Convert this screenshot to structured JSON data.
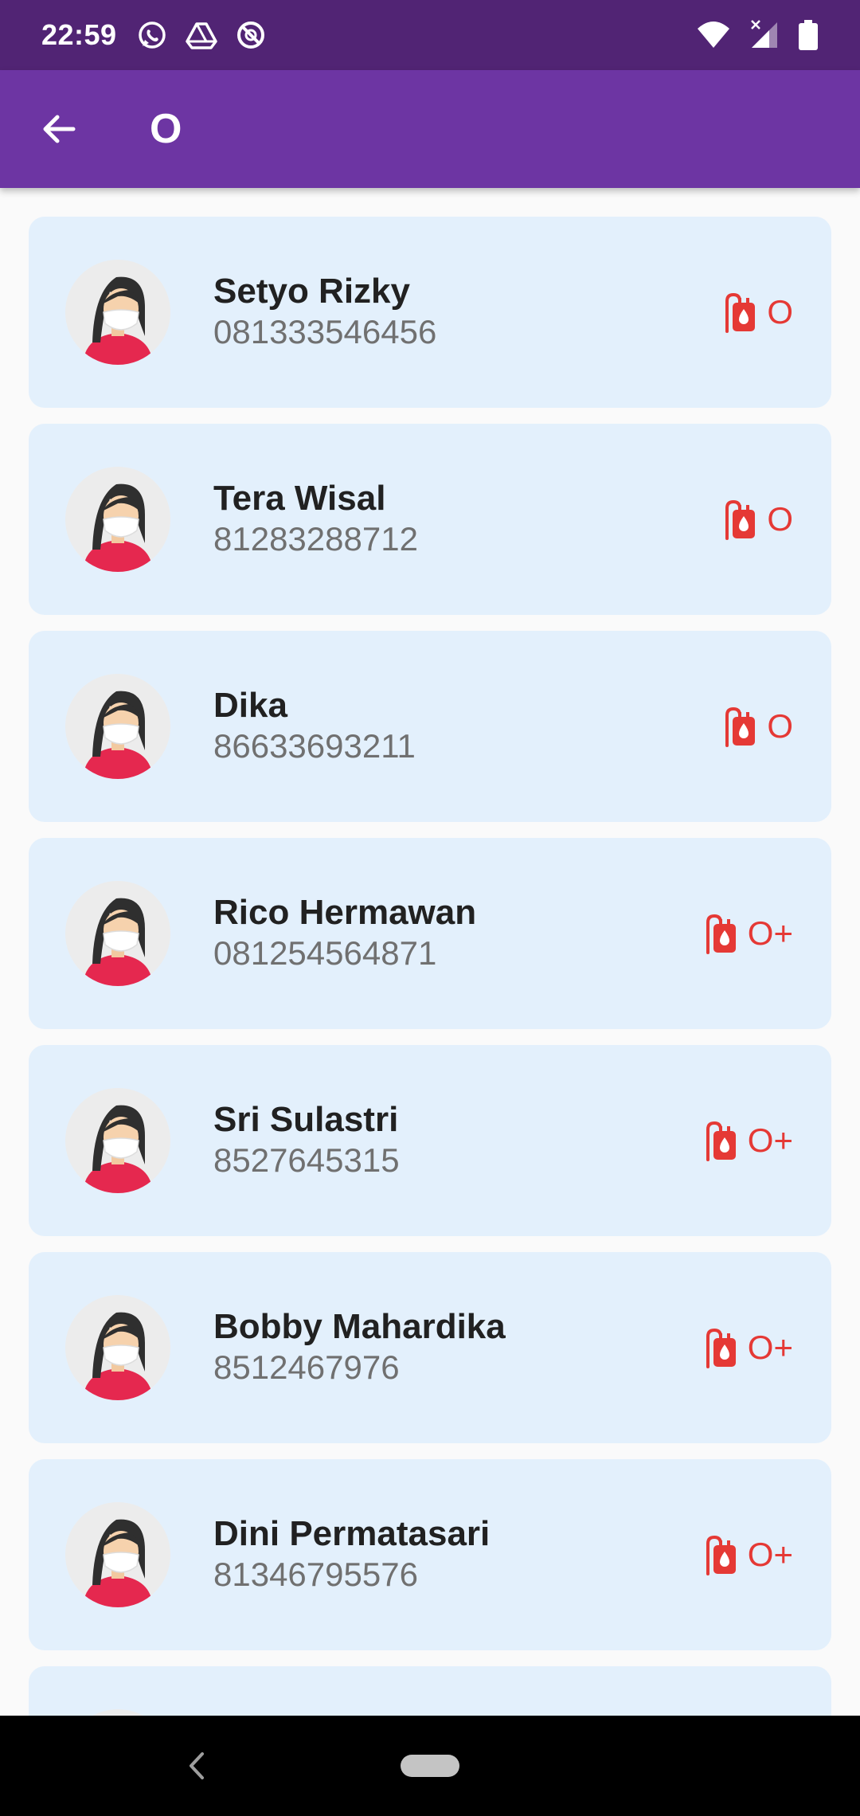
{
  "status_bar": {
    "time": "22:59",
    "notification_icons": [
      "whatsapp-icon",
      "drive-icon",
      "sync-disabled-icon"
    ],
    "system_icons": [
      "wifi-icon",
      "signal-icon",
      "battery-icon"
    ]
  },
  "app_bar": {
    "back_icon": "arrow-back-icon",
    "title": "O"
  },
  "colors": {
    "status_bar": "#512474",
    "app_bar": "#6d35a3",
    "card_background": "#e3f0fc",
    "blood_accent": "#e53935"
  },
  "donors": [
    {
      "name": "Setyo Rizky",
      "phone": "081333546456",
      "blood_type": "O"
    },
    {
      "name": "Tera Wisal",
      "phone": "81283288712",
      "blood_type": "O"
    },
    {
      "name": "Dika",
      "phone": "86633693211",
      "blood_type": "O"
    },
    {
      "name": "Rico Hermawan",
      "phone": "081254564871",
      "blood_type": "O+"
    },
    {
      "name": "Sri Sulastri",
      "phone": "8527645315",
      "blood_type": "O+"
    },
    {
      "name": "Bobby Mahardika",
      "phone": "8512467976",
      "blood_type": "O+"
    },
    {
      "name": "Dini Permatasari",
      "phone": "81346795576",
      "blood_type": "O+"
    },
    {
      "name": "",
      "phone": "",
      "blood_type": ""
    }
  ],
  "nav_bar": {
    "back_icon": "nav-back-icon",
    "home_icon": "nav-home-pill-icon"
  }
}
